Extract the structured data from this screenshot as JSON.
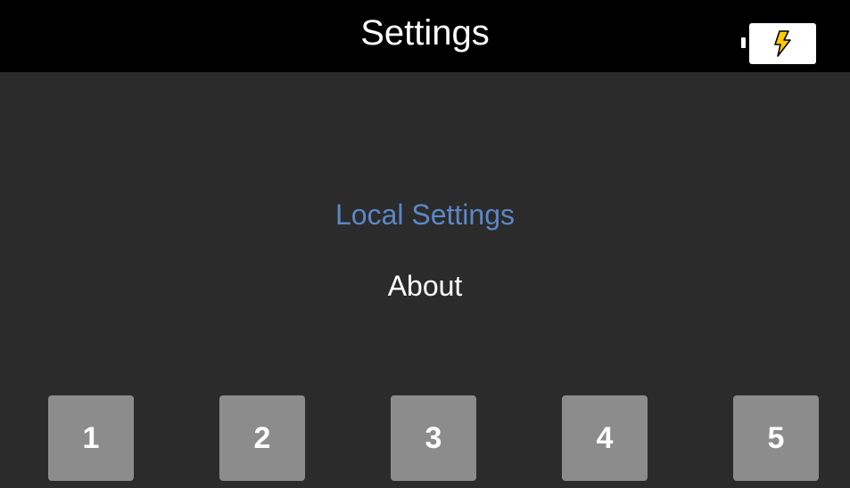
{
  "header": {
    "title": "Settings",
    "battery_icon": "battery-charging-icon",
    "battery_bolt_color": "#ffcc00"
  },
  "menu": {
    "items": [
      {
        "label": "Local Settings",
        "selected": true
      },
      {
        "label": "About",
        "selected": false
      }
    ],
    "selected_color": "#5b87c7"
  },
  "keys": [
    {
      "label": "1"
    },
    {
      "label": "2"
    },
    {
      "label": "3"
    },
    {
      "label": "4"
    },
    {
      "label": "5"
    }
  ]
}
